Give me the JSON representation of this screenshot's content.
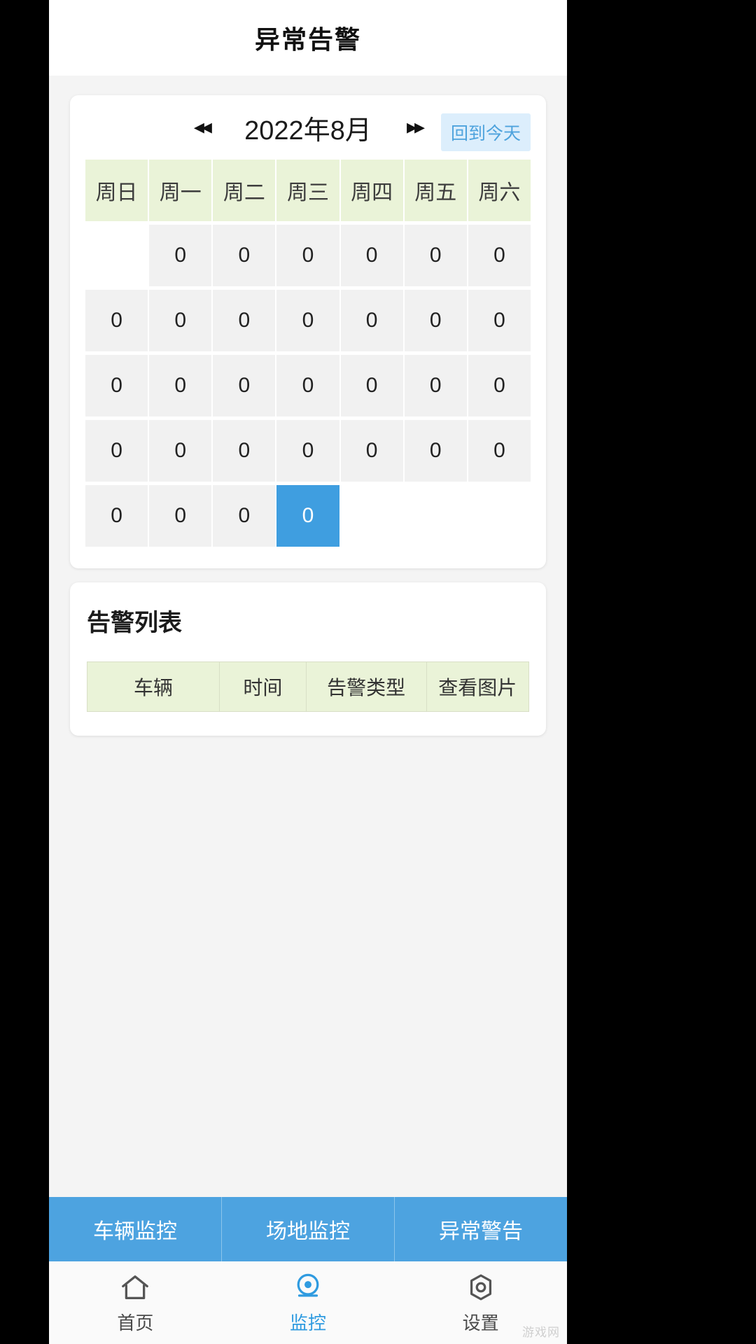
{
  "header": {
    "title": "异常告警"
  },
  "calendar": {
    "prev_label": "◂◂",
    "next_label": "▸▸",
    "month_label": "2022年8月",
    "today_button": "回到今天",
    "weekdays": [
      "周日",
      "周一",
      "周二",
      "周三",
      "周四",
      "周五",
      "周六"
    ],
    "selected_color": "#3f9ee0",
    "header_bg": "#eaf3d8",
    "cell_bg": "#f1f1f1",
    "rows": [
      {
        "cells": [
          {
            "value": "",
            "empty": true,
            "selected": false
          },
          {
            "value": "0",
            "empty": false,
            "selected": false
          },
          {
            "value": "0",
            "empty": false,
            "selected": false
          },
          {
            "value": "0",
            "empty": false,
            "selected": false
          },
          {
            "value": "0",
            "empty": false,
            "selected": false
          },
          {
            "value": "0",
            "empty": false,
            "selected": false
          },
          {
            "value": "0",
            "empty": false,
            "selected": false
          }
        ]
      },
      {
        "cells": [
          {
            "value": "0",
            "empty": false,
            "selected": false
          },
          {
            "value": "0",
            "empty": false,
            "selected": false
          },
          {
            "value": "0",
            "empty": false,
            "selected": false
          },
          {
            "value": "0",
            "empty": false,
            "selected": false
          },
          {
            "value": "0",
            "empty": false,
            "selected": false
          },
          {
            "value": "0",
            "empty": false,
            "selected": false
          },
          {
            "value": "0",
            "empty": false,
            "selected": false
          }
        ]
      },
      {
        "cells": [
          {
            "value": "0",
            "empty": false,
            "selected": false
          },
          {
            "value": "0",
            "empty": false,
            "selected": false
          },
          {
            "value": "0",
            "empty": false,
            "selected": false
          },
          {
            "value": "0",
            "empty": false,
            "selected": false
          },
          {
            "value": "0",
            "empty": false,
            "selected": false
          },
          {
            "value": "0",
            "empty": false,
            "selected": false
          },
          {
            "value": "0",
            "empty": false,
            "selected": false
          }
        ]
      },
      {
        "cells": [
          {
            "value": "0",
            "empty": false,
            "selected": false
          },
          {
            "value": "0",
            "empty": false,
            "selected": false
          },
          {
            "value": "0",
            "empty": false,
            "selected": false
          },
          {
            "value": "0",
            "empty": false,
            "selected": false
          },
          {
            "value": "0",
            "empty": false,
            "selected": false
          },
          {
            "value": "0",
            "empty": false,
            "selected": false
          },
          {
            "value": "0",
            "empty": false,
            "selected": false
          }
        ]
      },
      {
        "cells": [
          {
            "value": "0",
            "empty": false,
            "selected": false
          },
          {
            "value": "0",
            "empty": false,
            "selected": false
          },
          {
            "value": "0",
            "empty": false,
            "selected": false
          },
          {
            "value": "0",
            "empty": false,
            "selected": true
          },
          {
            "value": "",
            "empty": true,
            "selected": false
          },
          {
            "value": "",
            "empty": true,
            "selected": false
          },
          {
            "value": "",
            "empty": true,
            "selected": false
          }
        ]
      }
    ]
  },
  "alert_list": {
    "title": "告警列表",
    "columns": [
      "车辆",
      "时间",
      "告警类型",
      "查看图片"
    ],
    "rows": []
  },
  "segment_tabs": {
    "items": [
      {
        "label": "车辆监控",
        "active": false
      },
      {
        "label": "场地监控",
        "active": false
      },
      {
        "label": "异常警告",
        "active": true
      }
    ],
    "bg_color": "#4da3e0"
  },
  "bottom_nav": {
    "items": [
      {
        "label": "首页",
        "icon": "home-icon",
        "active": false
      },
      {
        "label": "监控",
        "icon": "camera-icon",
        "active": true
      },
      {
        "label": "设置",
        "icon": "gear-icon",
        "active": false
      }
    ],
    "active_color": "#2f9be0"
  },
  "watermark": {
    "text": "游戏网"
  }
}
